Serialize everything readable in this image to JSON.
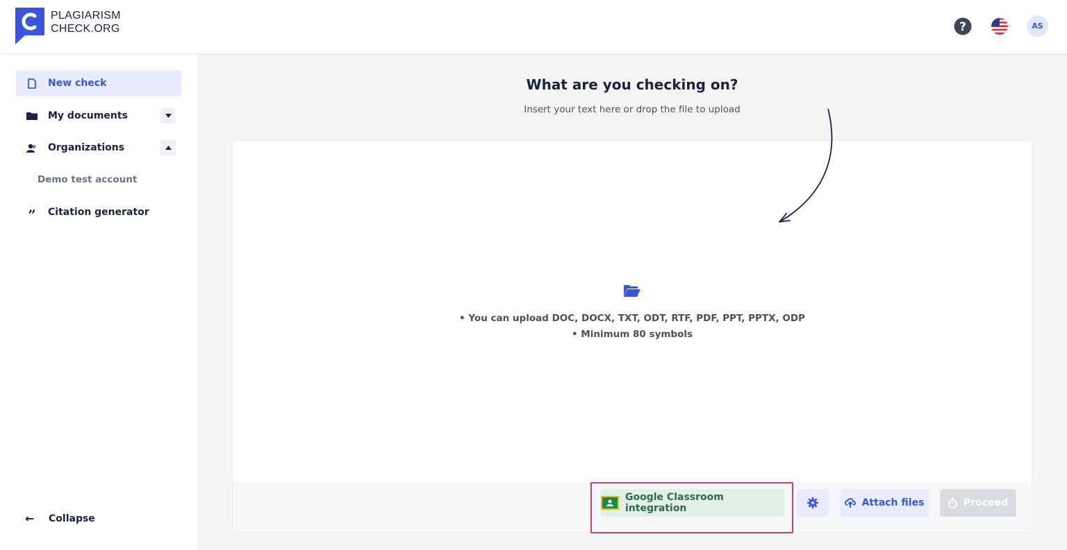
{
  "header": {
    "logo_line1": "PLAGIARISM",
    "logo_line2": "CHECK.ORG",
    "avatar_initials": "AS",
    "help_icon": "question-circle-icon",
    "language_icon": "us-flag-icon"
  },
  "sidebar": {
    "items": [
      {
        "label": "New check",
        "icon": "document-icon",
        "active": true
      },
      {
        "label": "My documents",
        "icon": "folder-icon",
        "expanded": false
      },
      {
        "label": "Organizations",
        "icon": "users-icon",
        "expanded": true
      },
      {
        "label": "Citation generator",
        "icon": "quote-icon"
      }
    ],
    "sub_items": [
      {
        "label": "Demo test account"
      }
    ],
    "collapse_label": "Collapse"
  },
  "main": {
    "title": "What are you checking on?",
    "subtitle": "Insert your text here or drop the file to upload",
    "hints": [
      "You can upload DOC, DOCX, TXT, ODT, RTF, PDF, PPT, PPTX, ODP",
      "Minimum 80 symbols"
    ]
  },
  "toolbar": {
    "classroom_label": "Google Classroom integration",
    "attach_label": "Attach files",
    "proceed_label": "Proceed",
    "proceed_enabled": false
  },
  "colors": {
    "accent": "#3b55d9",
    "classroom_bg": "#e2f1e8",
    "highlight": "#c9406e"
  }
}
